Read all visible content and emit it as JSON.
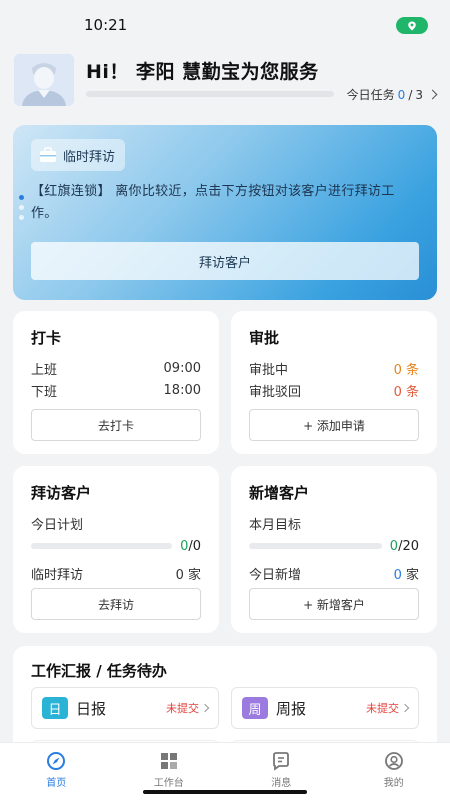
{
  "status_bar": {
    "time": "10:21"
  },
  "header": {
    "greeting": "Hi！ 李阳 慧勤宝为您服务",
    "task_label": "今日任务",
    "task_done": "0",
    "task_sep": " / ",
    "task_total": "3"
  },
  "visit_card": {
    "tag": "临时拜访",
    "message": "【红旗连锁】 离你比较近，点击下方按钮对该客户进行拜访工作。",
    "button": "拜访客户"
  },
  "clock_card": {
    "title": "打卡",
    "rows": [
      {
        "label": "上班",
        "value": "09:00"
      },
      {
        "label": "下班",
        "value": "18:00"
      }
    ],
    "button": "去打卡"
  },
  "approval_card": {
    "title": "审批",
    "rows": [
      {
        "label": "审批中",
        "value": "0 条"
      },
      {
        "label": "审批驳回",
        "value": "0 条"
      }
    ],
    "button": "+ 添加申请"
  },
  "visit_stats_card": {
    "title": "拜访客户",
    "plan_label": "今日计划",
    "plan_done": "0",
    "plan_total": "/0",
    "plan_progress": 0,
    "temp_label": "临时拜访",
    "temp_value": "0 家",
    "button": "去拜访"
  },
  "new_customer_card": {
    "title": "新增客户",
    "target_label": "本月目标",
    "target_done": "0",
    "target_total": "/20",
    "target_progress": 0,
    "today_label": "今日新增",
    "today_num": "0",
    "today_unit": " 家",
    "button": "+ 新增客户"
  },
  "report_card": {
    "title": "工作汇报 / 任务待办",
    "items": [
      {
        "icon": "日",
        "label": "日报",
        "status": "未提交",
        "color": "#2bb3d6"
      },
      {
        "icon": "周",
        "label": "周报",
        "status": "未提交",
        "color": "#9b7be0"
      }
    ]
  },
  "tabbar": {
    "items": [
      {
        "label": "首页",
        "icon": "home-icon",
        "active": true
      },
      {
        "label": "工作台",
        "icon": "grid-icon",
        "active": false
      },
      {
        "label": "消息",
        "icon": "message-icon",
        "active": false
      },
      {
        "label": "我的",
        "icon": "user-icon",
        "active": false
      }
    ]
  }
}
